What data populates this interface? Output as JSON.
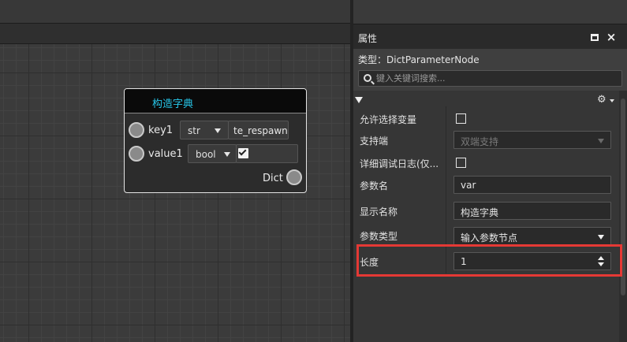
{
  "graph": {
    "node": {
      "title": "构造字典",
      "rows": [
        {
          "label": "key1",
          "type": "str",
          "value": "te_respawn"
        },
        {
          "label": "value1",
          "type": "bool",
          "value": true
        }
      ],
      "output_label": "Dict"
    }
  },
  "panel": {
    "title": "属性",
    "type_line": "类型：DictParameterNode",
    "search_placeholder": "键入关键词搜索...",
    "properties": [
      {
        "label": "允许选择变量",
        "kind": "checkbox",
        "checked": false
      },
      {
        "label": "支持端",
        "kind": "dropdown",
        "value": "双端支持",
        "disabled": true
      },
      {
        "label": "详细调试日志(仅...",
        "kind": "checkbox",
        "checked": false
      },
      {
        "label": "参数名",
        "kind": "text",
        "value": "var"
      },
      {
        "label": "显示名称",
        "kind": "text",
        "value": "构造字典"
      },
      {
        "label": "参数类型",
        "kind": "dropdown",
        "value": "输入参数节点",
        "disabled": false
      },
      {
        "label": "长度",
        "kind": "spinner",
        "value": "1"
      }
    ]
  },
  "colors": {
    "node_title": "#27c7ea",
    "highlight": "#e53935"
  },
  "icons": [
    "search-icon",
    "gear-icon",
    "collapse-arrow-icon",
    "maximize-icon",
    "close-icon",
    "checkmark-icon"
  ]
}
